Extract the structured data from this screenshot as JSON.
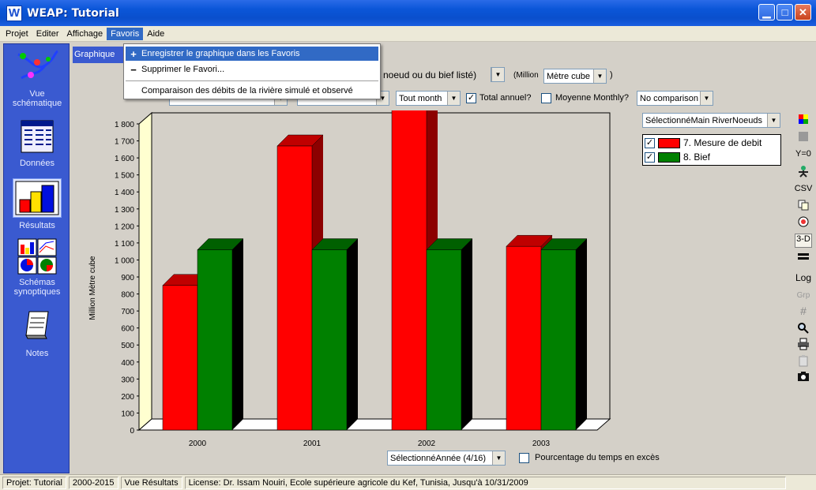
{
  "window": {
    "title": "WEAP: Tutorial",
    "app_icon": "W"
  },
  "menubar": {
    "items": [
      "Projet",
      "Editer",
      "Affichage",
      "Favoris",
      "Aide"
    ],
    "active": "Favoris"
  },
  "favoris_menu": {
    "items": [
      {
        "glyph": "+",
        "label": "Enregistrer le graphique dans les Favoris"
      },
      {
        "glyph": "−",
        "label": "Supprimer le Favori..."
      },
      {
        "glyph": "",
        "label": "Comparaison des débits de la rivière simulé et observé"
      }
    ]
  },
  "sidebar": {
    "items": [
      {
        "label": "Vue schématique"
      },
      {
        "label": "Données"
      },
      {
        "label": "Résultats"
      },
      {
        "label": "Schémas synoptiques"
      },
      {
        "label": "Notes"
      }
    ]
  },
  "tab": {
    "label": "Graphique"
  },
  "toolbar": {
    "variable_combo": "noeud ou du bief listé)",
    "unit_prefix": "(Million",
    "unit_combo": "Mètre cube",
    "unit_suffix": ")",
    "month_combo": "Tout month",
    "total_annuel_label": "Total annuel?",
    "total_annuel_checked": true,
    "moyenne_label": "Moyenne Monthly?",
    "moyenne_checked": false,
    "comparison_combo": "No comparison"
  },
  "series_selector": "SélectionnéMain RiverNoeuds",
  "legend": [
    {
      "label": "7. Mesure de debit",
      "color": "#ff0000",
      "checked": true
    },
    {
      "label": "8. Bief",
      "color": "#008000",
      "checked": true
    }
  ],
  "chart_data": {
    "type": "bar",
    "categories": [
      "2000",
      "2001",
      "2002",
      "2003"
    ],
    "series": [
      {
        "name": "7. Mesure de debit",
        "values": [
          850,
          1670,
          1900,
          1080
        ],
        "color": "#ff0000"
      },
      {
        "name": "8. Bief",
        "values": [
          1060,
          1060,
          1060,
          1060
        ],
        "color": "#008000"
      }
    ],
    "ylabel": "Million Mètre cube",
    "ylim": [
      0,
      1800
    ],
    "yticks": [
      "0",
      "100",
      "200",
      "300",
      "400",
      "500",
      "600",
      "700",
      "800",
      "900",
      "1 000",
      "1 100",
      "1 200",
      "1 300",
      "1 400",
      "1 500",
      "1 600",
      "1 700",
      "1 800"
    ],
    "style": "3D"
  },
  "bottom": {
    "year_combo": "SélectionnéAnnée (4/16)",
    "pourcentage_label": "Pourcentage du temps en excès",
    "pourcentage_checked": false
  },
  "right_toolbar": [
    "palette-icon",
    "stop-icon",
    "Y=0",
    "figure-icon",
    "CSV",
    "copy-icon",
    "globe-icon",
    "3-D",
    "lines-icon",
    "Log",
    "Grp",
    "grid-icon",
    "zoom-icon",
    "print-icon",
    "clipboard-icon",
    "camera-icon"
  ],
  "statusbar": {
    "project": "Projet: Tutorial",
    "years": "2000-2015",
    "view": "Vue Résultats",
    "license": "License: Dr. Issam Nouiri, Ecole supérieure agricole du Kef, Tunisia, Jusqu'à 10/31/2009"
  }
}
